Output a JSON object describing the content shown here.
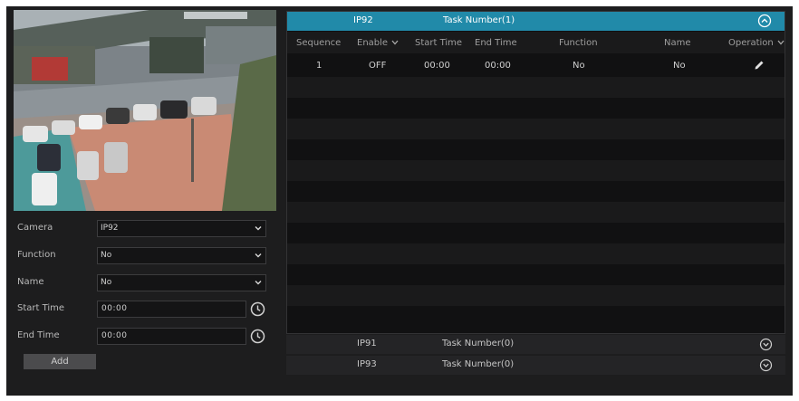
{
  "form": {
    "camera_label": "Camera",
    "camera_value": "IP92",
    "function_label": "Function",
    "function_value": "No",
    "name_label": "Name",
    "name_value": "No",
    "start_time_label": "Start Time",
    "start_time_value": "00:00",
    "end_time_label": "End Time",
    "end_time_value": "00:00",
    "add_label": "Add"
  },
  "panel": {
    "camera": "IP92",
    "task_number": "Task Number(1)",
    "columns": {
      "sequence": "Sequence",
      "enable": "Enable",
      "start_time": "Start Time",
      "end_time": "End Time",
      "function": "Function",
      "name": "Name",
      "operation": "Operation"
    },
    "rows": [
      {
        "sequence": "1",
        "enable": "OFF",
        "start_time": "00:00",
        "end_time": "00:00",
        "function": "No",
        "name": "No"
      }
    ]
  },
  "groups": [
    {
      "camera": "IP91",
      "task_number": "Task Number(0)"
    },
    {
      "camera": "IP93",
      "task_number": "Task Number(0)"
    }
  ],
  "colors": {
    "accent": "#218aa9",
    "background": "#1d1d1e"
  },
  "icons": {
    "select_arrow": "chevron-down-icon",
    "time_picker": "clock-icon",
    "header_toggle": "chevron-up-icon",
    "group_toggle": "chevron-down-icon",
    "edit": "pencil-icon"
  }
}
